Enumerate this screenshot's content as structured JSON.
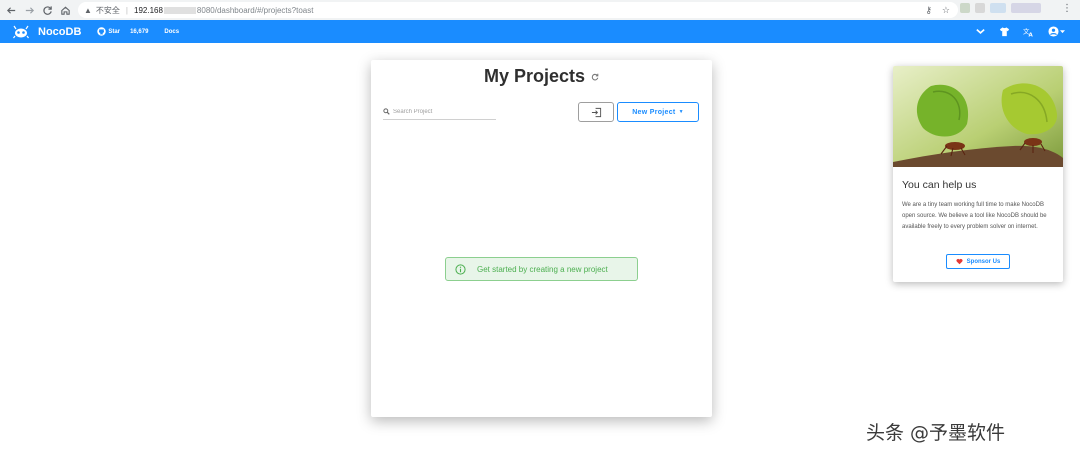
{
  "browser": {
    "security_label": "不安全",
    "url_host": "192.168",
    "url_rest": "8080/dashboard/#/projects?toast"
  },
  "header": {
    "brand": "NocoDB",
    "star_label": "Star",
    "star_count": "16,679",
    "docs_label": "Docs",
    "brand_color": "#1a8cff"
  },
  "projects": {
    "title": "My Projects",
    "search_placeholder": "Search Project",
    "new_project_label": "New Project",
    "empty_message": "Get started by creating a new project"
  },
  "sponsor": {
    "title": "You can help us",
    "description": "We are a tiny team working full time to make NocoDB open source. We believe a tool like NocoDB should be available freely to every problem solver on internet.",
    "button_label": "Sponsor Us"
  },
  "watermark": {
    "text": "头条 @予墨软件"
  }
}
